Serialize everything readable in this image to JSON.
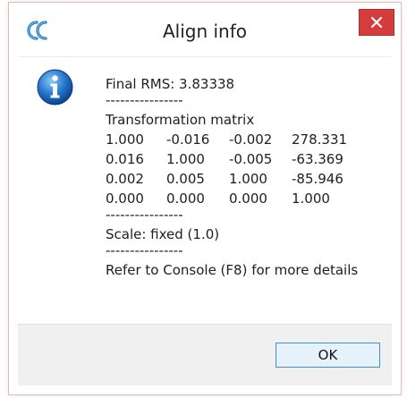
{
  "window": {
    "title": "Align info",
    "app_icon": "cloudcompare-icon",
    "close_icon": "close-icon"
  },
  "dialog": {
    "icon": "info-icon",
    "rms_line": "Final RMS: 3.83338",
    "separator": "----------------",
    "matrix_label": "Transformation matrix",
    "matrix": [
      [
        "1.000",
        "-0.016",
        "-0.002",
        "278.331"
      ],
      [
        "0.016",
        "1.000",
        "-0.005",
        "-63.369"
      ],
      [
        "0.002",
        "0.005",
        "1.000",
        "-85.946"
      ],
      [
        "0.000",
        "0.000",
        "0.000",
        "1.000"
      ]
    ],
    "scale_line": "Scale: fixed (1.0)",
    "console_line": "Refer to Console (F8) for more details"
  },
  "buttons": {
    "ok_label": "OK"
  },
  "colors": {
    "close_button": "#d53c3c",
    "ok_border": "#3c8fd8",
    "footer_bg": "#f0f0f0"
  }
}
